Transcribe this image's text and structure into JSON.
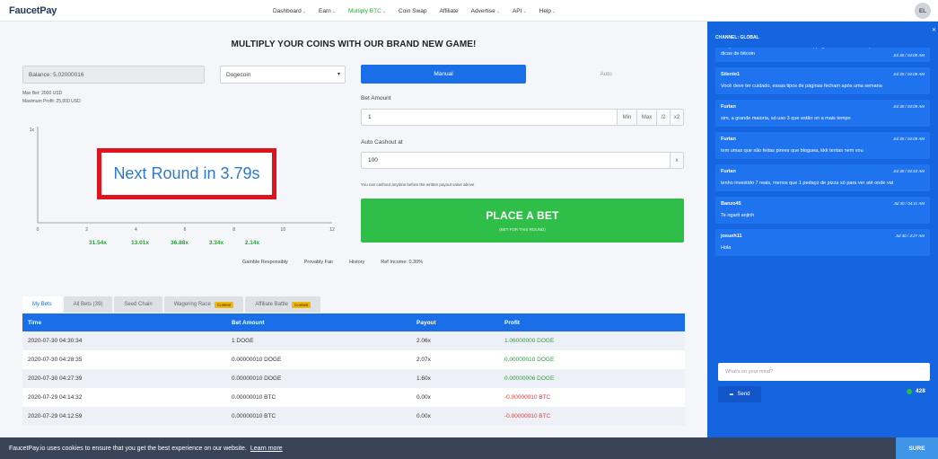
{
  "nav": {
    "logo": "FaucetPay",
    "links": [
      {
        "label": "Dashboard",
        "caret": true
      },
      {
        "label": "Earn",
        "caret": true
      },
      {
        "label": "Multiply BTC",
        "caret": true,
        "active": true
      },
      {
        "label": "Coin Swap",
        "caret": false
      },
      {
        "label": "Affiliate",
        "caret": false
      },
      {
        "label": "Advertise",
        "caret": true
      },
      {
        "label": "API",
        "caret": true
      },
      {
        "label": "Help",
        "caret": true
      }
    ],
    "avatar": "EL"
  },
  "game": {
    "title": "MULTIPLY YOUR COINS WITH OUR BRAND NEW GAME!",
    "balance": "Balance: 5.02000016",
    "coin": "Dogecoin",
    "max_bet": "Max Bet: 2000 USD",
    "max_profit": "Maximum Profit: 25,000 USD",
    "next_round": "Next Round in 3.79s",
    "history": [
      "31.54x",
      "13.01x",
      "36.88x",
      "3.34x",
      "2.14x"
    ]
  },
  "chart_data": {
    "type": "line",
    "x_ticks": [
      "0",
      "2",
      "4",
      "6",
      "8",
      "10",
      "12"
    ],
    "y_ticks": [
      "1x"
    ],
    "series": []
  },
  "links": [
    "Gamble Responsibly",
    "Provably Fair",
    "History",
    "Ref Income: 0.30%"
  ],
  "bet": {
    "mode_manual": "Manual",
    "mode_auto": "Auto",
    "amount_label": "Bet Amount",
    "amount": "1",
    "buttons": [
      "Min",
      "Max",
      "/2",
      "x2"
    ],
    "cashout_label": "Auto Cashout at",
    "cashout": "100",
    "cashout_suffix": "x",
    "cashout_note": "You can cashout anytime before the written payout value above",
    "place_bet": "PLACE A BET",
    "place_bet_sub": "(BET FOR THIS ROUND)"
  },
  "tabs": [
    {
      "label": "My Bets",
      "active": true
    },
    {
      "label": "All Bets (39)"
    },
    {
      "label": "Seed Chain"
    },
    {
      "label": "Wagering Race",
      "badge": "Contest"
    },
    {
      "label": "Affiliate Battle",
      "badge": "Contest"
    }
  ],
  "table": {
    "headers": [
      "Time",
      "Bet Amount",
      "Payout",
      "Profit"
    ],
    "rows": [
      [
        "2020-07-30 04:30:34",
        "1 DOGE",
        "2.06x",
        "1.06000000 DOGE",
        "pos"
      ],
      [
        "2020-07-30 04:28:35",
        "0.00000010 DOGE",
        "2.07x",
        "0.00000010 DOGE",
        "pos"
      ],
      [
        "2020-07-30 04:27:39",
        "0.00000010 DOGE",
        "1.60x",
        "0.00000006 DOGE",
        "pos"
      ],
      [
        "2020-07-29 04:14:32",
        "0.00000010 BTC",
        "0.00x",
        "-0.00000010 BTC",
        "neg"
      ],
      [
        "2020-07-29 04:12:59",
        "0.00000010 BTC",
        "0.00x",
        "-0.00000010 BTC",
        "neg"
      ]
    ]
  },
  "chat": {
    "channel": "CHANNEL: GLOBAL",
    "messages": [
      {
        "user": "",
        "time": "Jul 30 / 04:08 AM",
        "text": "so quase consultar se uma cidade no face, pagina barinho e bitcoin, tem um link faz com dicas de bitcoin"
      },
      {
        "user": "Silente1",
        "time": "Jul 30 / 04:08 AM",
        "text": "Você deve ter cuidado, essas tipos de páginas fecham após uma semana"
      },
      {
        "user": "Furian",
        "time": "Jul 30 / 04:09 AM",
        "text": "sim, a grande maioria, só uso 3 que estão on a mais tempo"
      },
      {
        "user": "Furian",
        "time": "Jul 30 / 04:09 AM",
        "text": "tem umas que são feitas pirees que bloguea, kkk tentas nem vou"
      },
      {
        "user": "Furian",
        "time": "Jul 30 / 04:10 AM",
        "text": "tenho investido 7 reais, menos que 1 pedaço de pizza só para ver até onde vai"
      },
      {
        "user": "Banzo45",
        "time": "Jul 30 / 04:11 AM",
        "text": "Te ngarti anjinh"
      },
      {
        "user": "josueh11",
        "time": "Jul 30 / 4:27 AM",
        "text": "Hola"
      }
    ],
    "input_placeholder": "What's on your mind?",
    "send": "Send",
    "online": "428"
  },
  "cookie": {
    "text": "FaucetPay.io uses cookies to ensure that you get the best experience on our website.",
    "learn_more": "Learn more",
    "sure": "SURE"
  },
  "colors": {
    "primary": "#1a6fe8",
    "success": "#2fbe47",
    "danger": "#e0141e",
    "chat_bg": "#1564e0",
    "cookie_bg": "#3a4458"
  }
}
